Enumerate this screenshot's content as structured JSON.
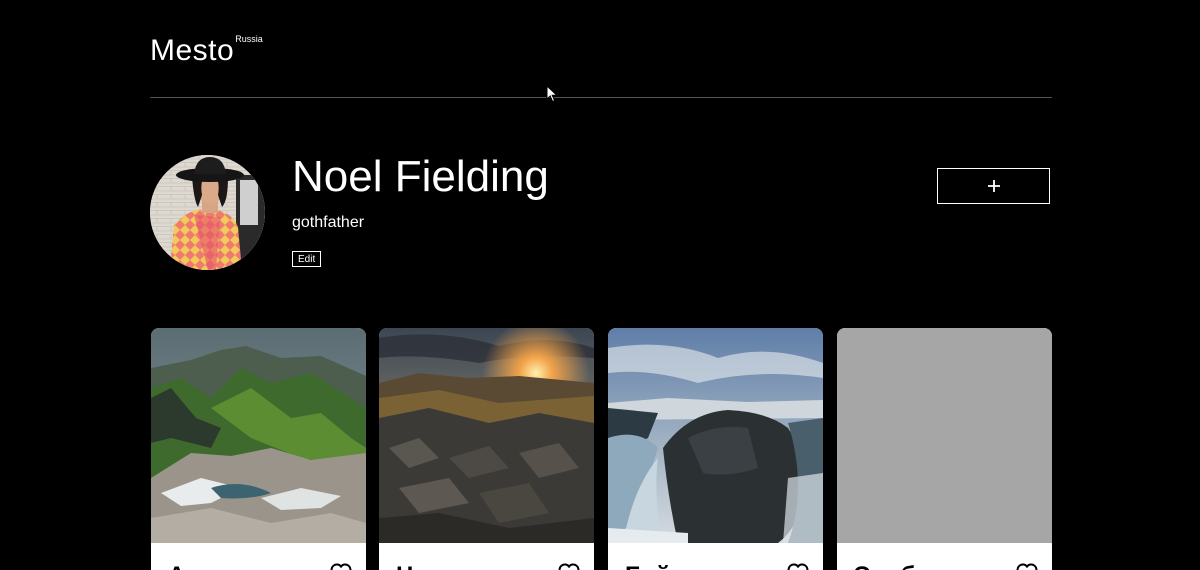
{
  "header": {
    "logo": "Mesto",
    "logo_suffix": "Russia"
  },
  "profile": {
    "name": "Noel Fielding",
    "about": "gothfather",
    "edit_label": "Edit",
    "add_label": "+"
  },
  "cards": [
    {
      "title": "Архыз",
      "like_icon": "heart-icon"
    },
    {
      "title": "Нурпин",
      "like_icon": "heart-icon"
    },
    {
      "title": "Байкал",
      "like_icon": "heart-icon"
    },
    {
      "title": "Эльбрус",
      "like_icon": "heart-icon"
    }
  ],
  "colors": {
    "background": "#000000",
    "text": "#ffffff",
    "divider": "#545454",
    "card_background": "#ffffff",
    "card_text": "#000000"
  }
}
